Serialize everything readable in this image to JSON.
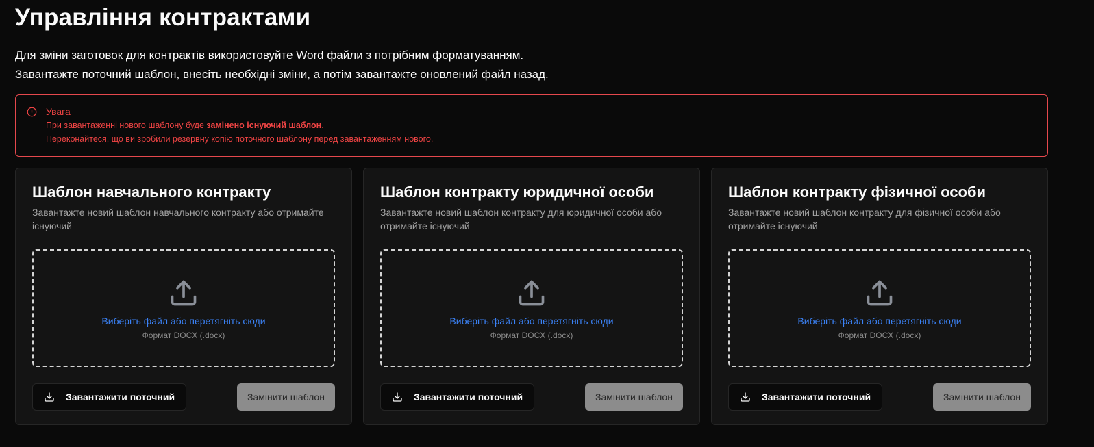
{
  "page": {
    "title": "Управління контрактами",
    "intro_line1": "Для зміни заготовок для контрактів використовуйте Word файли з потрібним форматуванням.",
    "intro_line2": "Завантажте поточний шаблон, внесіть необхідні зміни, а потім завантажте оновлений файл назад."
  },
  "alert": {
    "title": "Увага",
    "line1_prefix": "При завантаженні нового шаблону буде ",
    "line1_bold": "замінено існуючий шаблон",
    "line1_suffix": ".",
    "line2": "Переконайтеся, що ви зробили резервну копію поточного шаблону перед завантаженням нового.",
    "color": "#ef4444"
  },
  "cards": [
    {
      "title": "Шаблон навчального контракту",
      "description": "Завантажте новий шаблон навчального контракту або отримайте існуючий",
      "dropzone_link": "Виберіть файл або перетягніть сюди",
      "dropzone_format": "Формат DOCX (.docx)",
      "download_label": "Завантажити поточний",
      "replace_label": "Замінити шаблон"
    },
    {
      "title": "Шаблон контракту юридичної особи",
      "description": "Завантажте новий шаблон контракту для юридичної особи або отримайте існуючий",
      "dropzone_link": "Виберіть файл або перетягніть сюди",
      "dropzone_format": "Формат DOCX (.docx)",
      "download_label": "Завантажити поточний",
      "replace_label": "Замінити шаблон"
    },
    {
      "title": "Шаблон контракту фізичної особи",
      "description": "Завантажте новий шаблон контракту для фізичної особи або отримайте існуючий",
      "dropzone_link": "Виберіть файл або перетягніть сюди",
      "dropzone_format": "Формат DOCX (.docx)",
      "download_label": "Завантажити поточний",
      "replace_label": "Замінити шаблон"
    }
  ],
  "icons": {
    "alert": "alert-circle-icon",
    "upload": "upload-icon",
    "download": "download-icon"
  },
  "colors": {
    "background": "#0a0a0a",
    "card": "#141414",
    "link": "#3b82f6",
    "danger": "#ef4444",
    "disabled_button": "#8c8c8c"
  }
}
